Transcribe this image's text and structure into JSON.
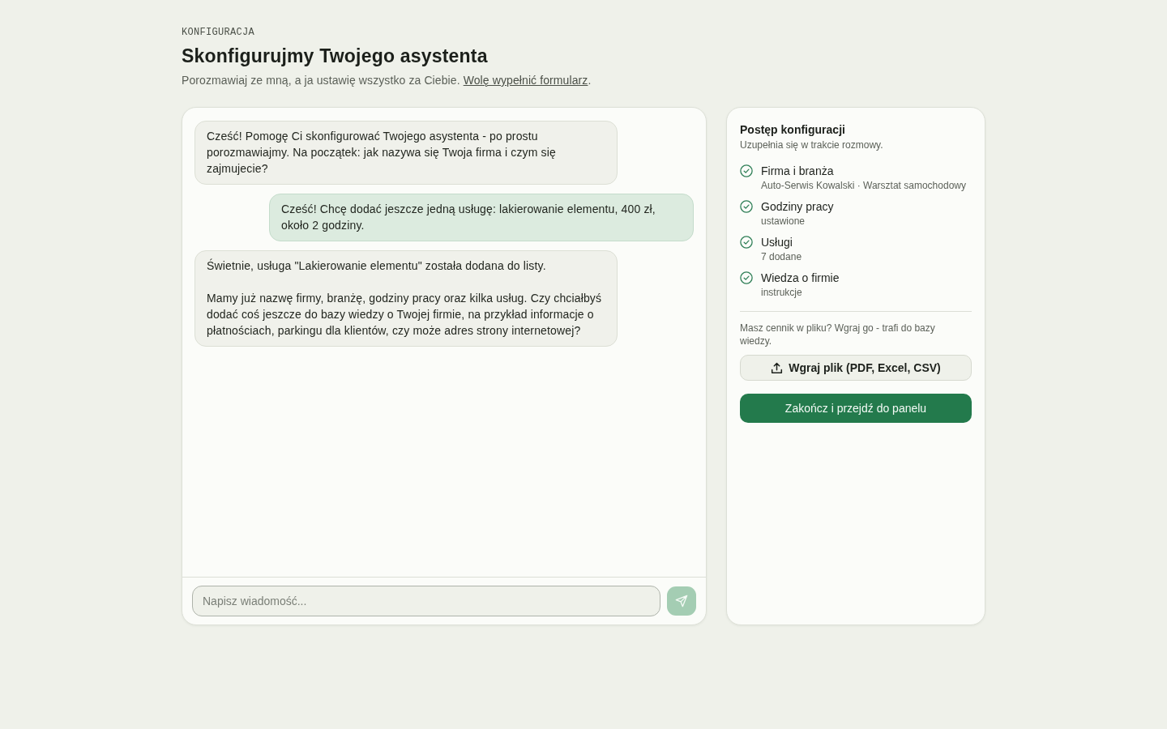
{
  "header": {
    "eyebrow": "KONFIGURACJA",
    "title": "Skonfigurujmy Twojego asystenta",
    "subtitle": "Porozmawiaj ze mną, a ja ustawię wszystko za Ciebie.",
    "subtitle_link": "Wolę wypełnić formularz",
    "subtitle_end": "."
  },
  "chat": {
    "messages": [
      {
        "kind": "assistant",
        "text": "Cześć! Pomogę Ci skonfigurować Twojego asystenta - po prostu porozmawiajmy. Na początek: jak nazywa się Twoja firma i czym się zajmujecie?"
      },
      {
        "kind": "user",
        "text": "Cześć! Chcę dodać jeszcze jedną usługę: lakierowanie elementu, 400 zł, około 2 godziny."
      },
      {
        "kind": "assistant",
        "text": "Świetnie, usługa \"Lakierowanie elementu\" została dodana do listy.\n\nMamy już nazwę firmy, branżę, godziny pracy oraz kilka usług. Czy chciałbyś dodać coś jeszcze do bazy wiedzy o Twojej firmie, na przykład informacje o płatnościach, parkingu dla klientów, czy może adres strony internetowej?"
      }
    ],
    "input": {
      "placeholder": "Napisz wiadomość..."
    },
    "send_button": {
      "disabled": true
    }
  },
  "progress": {
    "title": "Postęp konfiguracji",
    "subtitle": "Uzupełnia się w trakcie rozmowy.",
    "items": [
      {
        "label": "Firma i branża",
        "detail": "Auto-Serwis Kowalski · Warsztat samochodowy",
        "done": true
      },
      {
        "label": "Godziny pracy",
        "detail": "ustawione",
        "done": true
      },
      {
        "label": "Usługi",
        "detail": "7 dodane",
        "done": true
      },
      {
        "label": "Wiedza o firmie",
        "detail": "instrukcje",
        "done": true
      }
    ],
    "upload_note": "Masz cennik w pliku? Wgraj go - trafi do bazy wiedzy.",
    "upload_button": "Wgraj plik (PDF, Excel, CSV)",
    "finish_button": "Zakończ i przejdź do panelu"
  }
}
